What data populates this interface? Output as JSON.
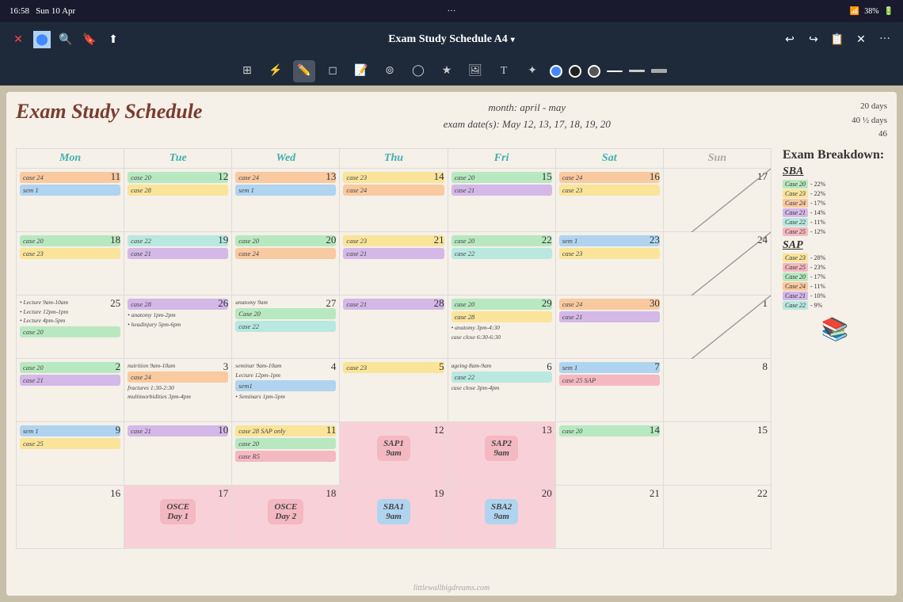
{
  "status_bar": {
    "time": "16:58",
    "day": "Sun 10 Apr",
    "dots": "···",
    "wifi": "📶",
    "battery": "38%"
  },
  "app_toolbar": {
    "title": "Exam Study Schedule A4",
    "close_label": "✕",
    "back_label": "↩",
    "forward_label": "↪",
    "more_label": "···"
  },
  "schedule": {
    "title": "Exam Study Schedule",
    "month": "month: april - may",
    "exam_dates": "exam date(s): May 12, 13, 17, 18, 19, 20",
    "counts": {
      "days": "20 days",
      "half_days": "40 ½ days",
      "number": "46"
    }
  },
  "days": [
    "Mon",
    "Tue",
    "Wed",
    "Thu",
    "Fri",
    "Sat",
    "Sun"
  ],
  "breakdown": {
    "title": "Exam Breakdown:",
    "sba_label": "SBA",
    "sba_items": [
      {
        "label": "Case 20",
        "pct": "22%",
        "color": "green"
      },
      {
        "label": "Case 23",
        "pct": "22%",
        "color": "yellow"
      },
      {
        "label": "Case 24",
        "pct": "17%",
        "color": "peach"
      },
      {
        "label": "Case 21",
        "pct": "14%",
        "color": "lavender"
      },
      {
        "label": "Case 22",
        "pct": "11%",
        "color": "mint"
      },
      {
        "label": "Case 25",
        "pct": "12%",
        "color": "pink"
      }
    ],
    "sap_label": "SAP",
    "sap_items": [
      {
        "label": "Case 23",
        "pct": "28%",
        "color": "yellow"
      },
      {
        "label": "Case 25",
        "pct": "23%",
        "color": "pink"
      },
      {
        "label": "Case 20",
        "pct": "17%",
        "color": "green"
      },
      {
        "label": "Case 24",
        "pct": "11%",
        "color": "peach"
      },
      {
        "label": "Case 21",
        "pct": "10%",
        "color": "lavender"
      },
      {
        "label": "Case 22",
        "pct": "9%",
        "color": "mint"
      }
    ]
  }
}
